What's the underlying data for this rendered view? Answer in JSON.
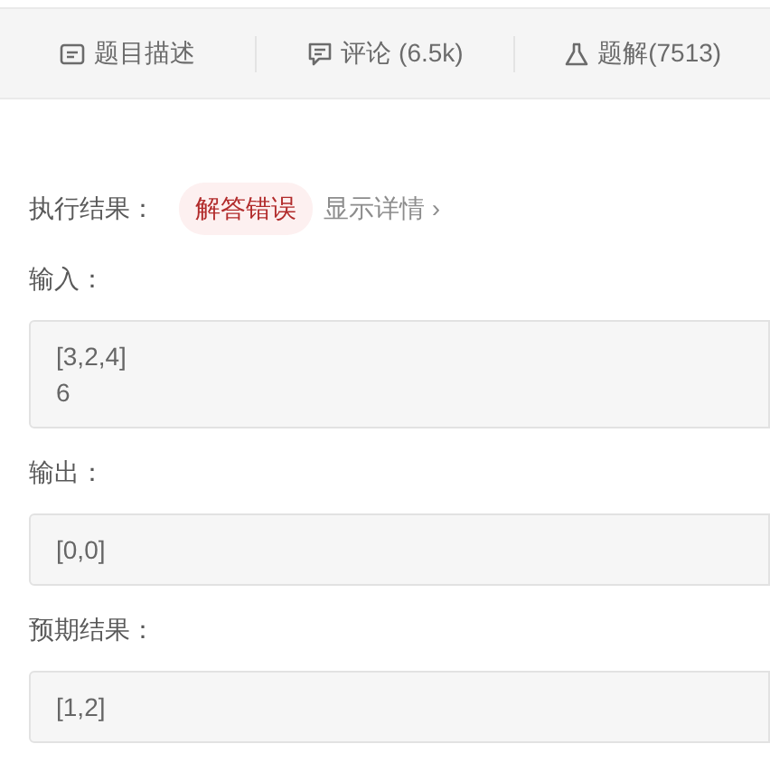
{
  "tabs": [
    {
      "label": "题目描述",
      "selected": false
    },
    {
      "label": "评论 (6.5k)",
      "selected": false
    },
    {
      "label": "题解(7513)",
      "selected": false
    }
  ],
  "result": {
    "label": "执行结果：",
    "status": "解答错误",
    "details_link": "显示详情",
    "details_arrow": "›"
  },
  "sections": [
    {
      "label": "输入：",
      "lines": [
        "[3,2,4]",
        "6"
      ]
    },
    {
      "label": "输出：",
      "lines": [
        "[0,0]"
      ]
    },
    {
      "label": "预期结果：",
      "lines": [
        "[1,2]"
      ]
    }
  ]
}
